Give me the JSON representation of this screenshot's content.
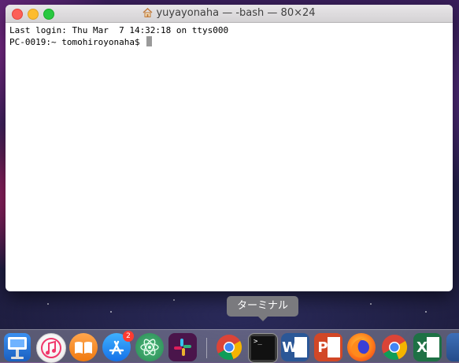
{
  "window": {
    "title": "yuyayonaha — -bash — 80×24",
    "lines": [
      "Last login: Thu Mar  7 14:32:18 on ttys000",
      "PC-0019:~ tomohiroyonaha$ "
    ]
  },
  "tooltip": {
    "text": "ターミナル"
  },
  "dock": {
    "app_store_badge": "2",
    "terminal_prompt": ">_",
    "word_letter": "W",
    "powerpoint_letter": "P",
    "excel_letter": "X"
  }
}
